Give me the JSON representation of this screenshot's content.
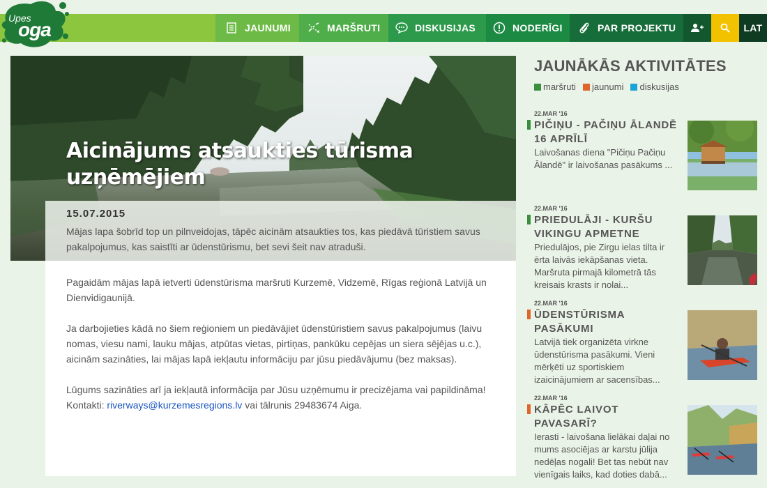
{
  "logo": {
    "top": "Upes",
    "main": "oga"
  },
  "nav": {
    "items": [
      {
        "label": "JAUNUMI",
        "icon": "document-icon"
      },
      {
        "label": "MARŠRUTI",
        "icon": "route-icon"
      },
      {
        "label": "DISKUSIJAS",
        "icon": "chat-icon"
      },
      {
        "label": "NODERĪGI",
        "icon": "info-icon"
      },
      {
        "label": "PAR PROJEKTU",
        "icon": "paperclip-icon"
      }
    ],
    "language": "LAT"
  },
  "article": {
    "title": "Aicinājums atsaukties tūrisma uzņēmējiem",
    "date": "15.07.2015",
    "lead": "Mājas lapa šobrīd top un pilnveidojas, tāpēc aicinām atsaukties tos, kas piedāvā tūristiem savus pakalpojumus, kas saistīti ar ūdenstūrismu, bet sevi šeit nav atraduši.",
    "p1": "Pagaidām mājas lapā ietverti ūdenstūrisma maršruti Kurzemē, Vidzemē, Rīgas reģionā Latvijā un Dienvidigaunijā.",
    "p2": "Ja darbojieties kādā no šiem reģioniem un piedāvājiet ūdenstūristiem savus pakalpojumus  (laivu nomas, viesu nami, lauku mājas, atpūtas vietas, pirtiņas, pankūku cepējas un siera sējējas u.c.), aicinām sazināties, lai mājas lapā iekļautu  informāciju par jūsu piedāvājumu (bez maksas).",
    "p3": "Lūgums sazināties arī ja iekļautā informācija par Jūsu uzņēmumu ir precizējama vai papildināma!",
    "contacts_label": "Kontakti: ",
    "email": "riverways@kurzemesregions.lv",
    "phone_text": " vai tālrunis 29483674 Aiga."
  },
  "sidebar": {
    "title": "JAUNĀKĀS AKTIVITĀTES",
    "legend": [
      {
        "label": "maršruti",
        "color": "#3a8f3f"
      },
      {
        "label": "jaunumi",
        "color": "#e0652a"
      },
      {
        "label": "diskusijas",
        "color": "#1aa3d8"
      }
    ],
    "activities": [
      {
        "date": "22.MAR '16",
        "title": "PIČIŅU - PAČIŅU ĀLANDĒ 16 APRĪLĪ",
        "text": "Laivošanas diena \"Pičiņu Pačiņu Ālandē\" ir laivošanas pasākums ...",
        "color": "#3a8f3f"
      },
      {
        "date": "22.MAR '16",
        "title": "PRIEDULĀJI - KURŠU VIKINGU APMETNE",
        "text": "Priedulājos, pie Zirgu ielas tilta ir ērta laivās iekāpšanas vieta. Maršruta pirmajā kilometrā tās kreisais krasts ir nolai...",
        "color": "#3a8f3f"
      },
      {
        "date": "22.MAR '16",
        "title": "ŪDENSTŪRISMA PASĀKUMI",
        "text": "Latvijā tiek organizēta virkne ūdenstūrisma pasākumi. Vieni mērķēti uz sportiskiem izaicinājumiem ar sacensības...",
        "color": "#e0652a"
      },
      {
        "date": "22.MAR '16",
        "title": "KĀPĒC LAIVOT PAVASARĪ?",
        "text": "Ierasti - laivošana lielākai daļai no mums asociējas ar karstu jūlija nedēļas nogali! Bet tas nebūt nav vienīgais laiks, kad doties dabā...",
        "color": "#e0652a"
      }
    ]
  }
}
